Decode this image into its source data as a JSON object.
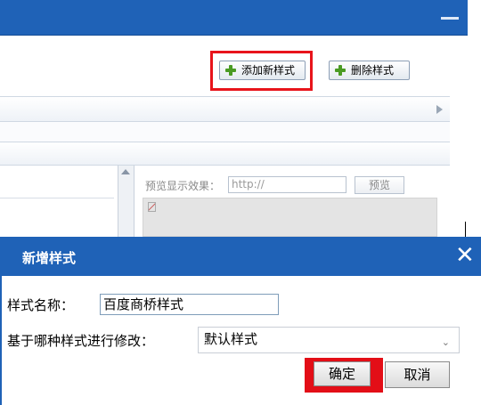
{
  "colors": {
    "titlebar": "#1f62b7",
    "highlight": "#e30e17",
    "plus": "#4a9b23"
  },
  "toolbar": {
    "add_style_label": "添加新样式",
    "delete_style_label": "删除样式"
  },
  "preview": {
    "label": "预览显示效果：",
    "url_value": "http://",
    "button_label": "预览"
  },
  "dialog": {
    "title": "新增样式",
    "close_glyph": "✕",
    "name_label": "样式名称：",
    "name_value": "百度商桥样式",
    "base_label": "基于哪种样式进行修改：",
    "base_value": "默认样式",
    "ok_label": "确定",
    "cancel_label": "取消"
  }
}
